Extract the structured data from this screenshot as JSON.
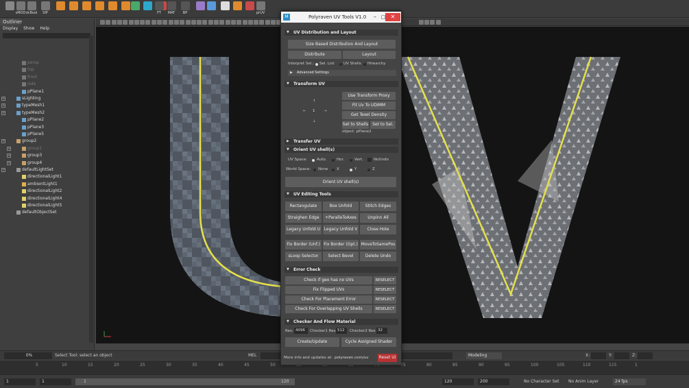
{
  "shelf": {
    "items": [
      {
        "label": "",
        "icon": "cube-icon",
        "color": "#888"
      },
      {
        "label": "sMOD",
        "icon": "mod-icon",
        "color": "#777"
      },
      {
        "label": "dcBool",
        "icon": "bool-icon",
        "color": "#777"
      },
      {
        "label": "SIP",
        "icon": "sip-icon",
        "color": "#777"
      },
      {
        "label": "",
        "icon": "sphere-icon",
        "color": "#e08a2e"
      },
      {
        "label": "",
        "icon": "cube-orange-icon",
        "color": "#e08a2e"
      },
      {
        "label": "",
        "icon": "cylinder-icon",
        "color": "#e08a2e"
      },
      {
        "label": "",
        "icon": "cone-icon",
        "color": "#e08a2e"
      },
      {
        "label": "",
        "icon": "torus-icon",
        "color": "#e08a2e"
      },
      {
        "label": "",
        "icon": "plane-icon",
        "color": "#e08a2e"
      },
      {
        "label": "",
        "icon": "grid-icon",
        "color": "#4aa86a"
      },
      {
        "label": "",
        "icon": "snap-icon",
        "color": "#2ea7c9"
      },
      {
        "label": "",
        "icon": "uv-icon",
        "color": "#c94a4a"
      },
      {
        "label": "FT",
        "icon": "ft-icon",
        "color": "#555"
      },
      {
        "label": "MAT",
        "icon": "mat-icon",
        "color": "#555"
      },
      {
        "label": "BP",
        "icon": "bp-icon",
        "color": "#555"
      },
      {
        "label": "",
        "icon": "bend-icon",
        "color": "#9a7ac9"
      },
      {
        "label": "",
        "icon": "globe-icon",
        "color": "#5a9ad9"
      },
      {
        "label": "",
        "icon": "bird-icon",
        "color": "#ddd"
      },
      {
        "label": "",
        "icon": "gear-icon",
        "color": "#e08a2e"
      },
      {
        "label": "",
        "icon": "paint-icon",
        "color": "#c94a4a"
      },
      {
        "label": "prUV",
        "icon": "pruv-icon",
        "color": "#777"
      }
    ]
  },
  "outliner": {
    "tab": "Outliner",
    "menu": [
      "Display",
      "Show",
      "Help"
    ],
    "rows": [
      {
        "label": "persp",
        "indent": 1,
        "exp": false,
        "dim": true,
        "icon": "camera-icon"
      },
      {
        "label": "top",
        "indent": 1,
        "exp": false,
        "dim": true,
        "icon": "camera-icon"
      },
      {
        "label": "front",
        "indent": 1,
        "exp": false,
        "dim": true,
        "icon": "camera-icon"
      },
      {
        "label": "side",
        "indent": 1,
        "exp": false,
        "dim": true,
        "icon": "camera-icon"
      },
      {
        "label": "pPlane1",
        "indent": 1,
        "exp": false,
        "dim": false,
        "icon": "mesh-icon"
      },
      {
        "label": "sLighting",
        "indent": 0,
        "exp": true,
        "dim": false,
        "icon": "mesh-icon"
      },
      {
        "label": "typeMesh1",
        "indent": 0,
        "exp": true,
        "dim": false,
        "icon": "mesh-icon"
      },
      {
        "label": "typeMesh2",
        "indent": 0,
        "exp": true,
        "dim": false,
        "icon": "mesh-icon"
      },
      {
        "label": "pPlane2",
        "indent": 1,
        "exp": false,
        "dim": false,
        "icon": "mesh-icon"
      },
      {
        "label": "pPlane3",
        "indent": 1,
        "exp": false,
        "dim": false,
        "icon": "mesh-icon"
      },
      {
        "label": "pPlane5",
        "indent": 1,
        "exp": false,
        "dim": false,
        "icon": "mesh-icon"
      },
      {
        "label": "group2",
        "indent": 0,
        "exp": true,
        "dim": false,
        "icon": "group-icon"
      },
      {
        "label": "group1",
        "indent": 1,
        "exp": true,
        "dim": true,
        "icon": "group-icon"
      },
      {
        "label": "group3",
        "indent": 1,
        "exp": true,
        "dim": false,
        "icon": "group-icon"
      },
      {
        "label": "group4",
        "indent": 1,
        "exp": true,
        "dim": false,
        "icon": "group-icon"
      },
      {
        "label": "defaultLightSet",
        "indent": 0,
        "exp": true,
        "dim": false,
        "icon": "set-icon"
      },
      {
        "label": "directionalLight1",
        "indent": 1,
        "exp": false,
        "dim": false,
        "icon": "light-icon"
      },
      {
        "label": "ambientLight1",
        "indent": 1,
        "exp": false,
        "dim": false,
        "icon": "sun-icon"
      },
      {
        "label": "directionalLight2",
        "indent": 1,
        "exp": false,
        "dim": false,
        "icon": "light-icon"
      },
      {
        "label": "directionalLight4",
        "indent": 1,
        "exp": false,
        "dim": false,
        "icon": "light-icon"
      },
      {
        "label": "directionalLight5",
        "indent": 1,
        "exp": false,
        "dim": false,
        "icon": "light-icon"
      },
      {
        "label": "defaultObjectSet",
        "indent": 0,
        "exp": false,
        "dim": false,
        "icon": "set-icon"
      }
    ]
  },
  "timeline": {
    "progress": "0%",
    "help_line": "Select Tool: select an object",
    "mel_label": "MEL",
    "workspace": "Modeling",
    "x_label": "X:",
    "y_label": "Y:",
    "z_label": "Z:",
    "ticks": [
      "5",
      "10",
      "15",
      "20",
      "25",
      "30",
      "35",
      "40",
      "45",
      "50",
      "55",
      "60",
      "65",
      "70",
      "75",
      "80",
      "85",
      "90",
      "95",
      "100",
      "105",
      "110",
      "115",
      "1"
    ]
  },
  "range": {
    "start": "1",
    "start2": "1",
    "slider_start": "1",
    "slider_end": "120",
    "end": "120",
    "end2": "200",
    "character": "No Character Set",
    "anim_layer": "No Anim Layer",
    "fps": "24 fps"
  },
  "window": {
    "title": "Polyraven UV Tools V1.0",
    "sections": {
      "distribution": "UV Distribution and Layout",
      "transform": "Transform UV",
      "transfer": "Transfer UV",
      "orient": "Orient UV shell(s)",
      "editing": "UV Editing Tools",
      "error": "Error Check",
      "checker": "Checker And Flow Material"
    },
    "dist": {
      "size_based": "Size Based Distribution And Layout",
      "distribute": "Distribute",
      "layout": "Layout",
      "interpret_label": "Interpret Sel.:",
      "opt_sel_list": "Sel. List",
      "opt_uv_shells": "UV Shells",
      "opt_hierarchy": "Hirearchy",
      "advanced": "Advanced Settings"
    },
    "transform": {
      "value": "1",
      "use_proxy": "Use Transform Proxy",
      "fit_udim": "Fit Uv To UDIMM",
      "texel": "Get Texel Density",
      "set_shells": "Set to Shells",
      "set_sel": "Set to Sel.",
      "object": "object: pPlane2"
    },
    "orient": {
      "uv_space": "UV Space:",
      "auto": "Auto.",
      "hor": "Hor.",
      "vert": "Vert.",
      "noundo": "NoUndo",
      "world_space": "World Space:",
      "none": "None",
      "x": "X",
      "y": "Y",
      "z": "Z",
      "button": "Orient UV shell(s)"
    },
    "editing": {
      "rows": [
        [
          "Rectangulate",
          "Box Unfold",
          "Stitch Edges"
        ],
        [
          "Straighen Edge",
          "+ParalleToAxes",
          "Unpinn All"
        ],
        [
          "Legacy Unfold U",
          "Legacy Unfold V",
          "Close Hole"
        ],
        [
          "Fix Border (Unf.)",
          "Fix Border (Opt.)",
          "MoveToSamePos"
        ],
        [
          "sLoop Selector",
          "Select Bevel",
          "Delete Undo"
        ]
      ]
    },
    "error": {
      "rows": [
        {
          "label": "Check if geo has no UVs",
          "reselect": "RESELECT"
        },
        {
          "label": "Fix Flipped UVs",
          "reselect": "RESELECT"
        },
        {
          "label": "Check For Placement Error",
          "reselect": "RESELECT"
        },
        {
          "label": "Check For Overlapping UV Shells",
          "reselect": "RESELECT"
        }
      ]
    },
    "checker": {
      "res_label": "Res:",
      "res": "4096",
      "c1_label": "Checker1 Res",
      "c1": "512",
      "c2_label": "Checker2 Res",
      "c2": "32",
      "create": "Create/Update",
      "cycle": "Cycle Assigned Shader"
    },
    "footer": {
      "info": "More info and updates at:",
      "link": "polyraven.com/uv",
      "reset": "Reset UI"
    }
  },
  "colors": {
    "accent_yellow": "#e6e04a",
    "reset_red": "#b83232",
    "close_red": "#e04343"
  }
}
